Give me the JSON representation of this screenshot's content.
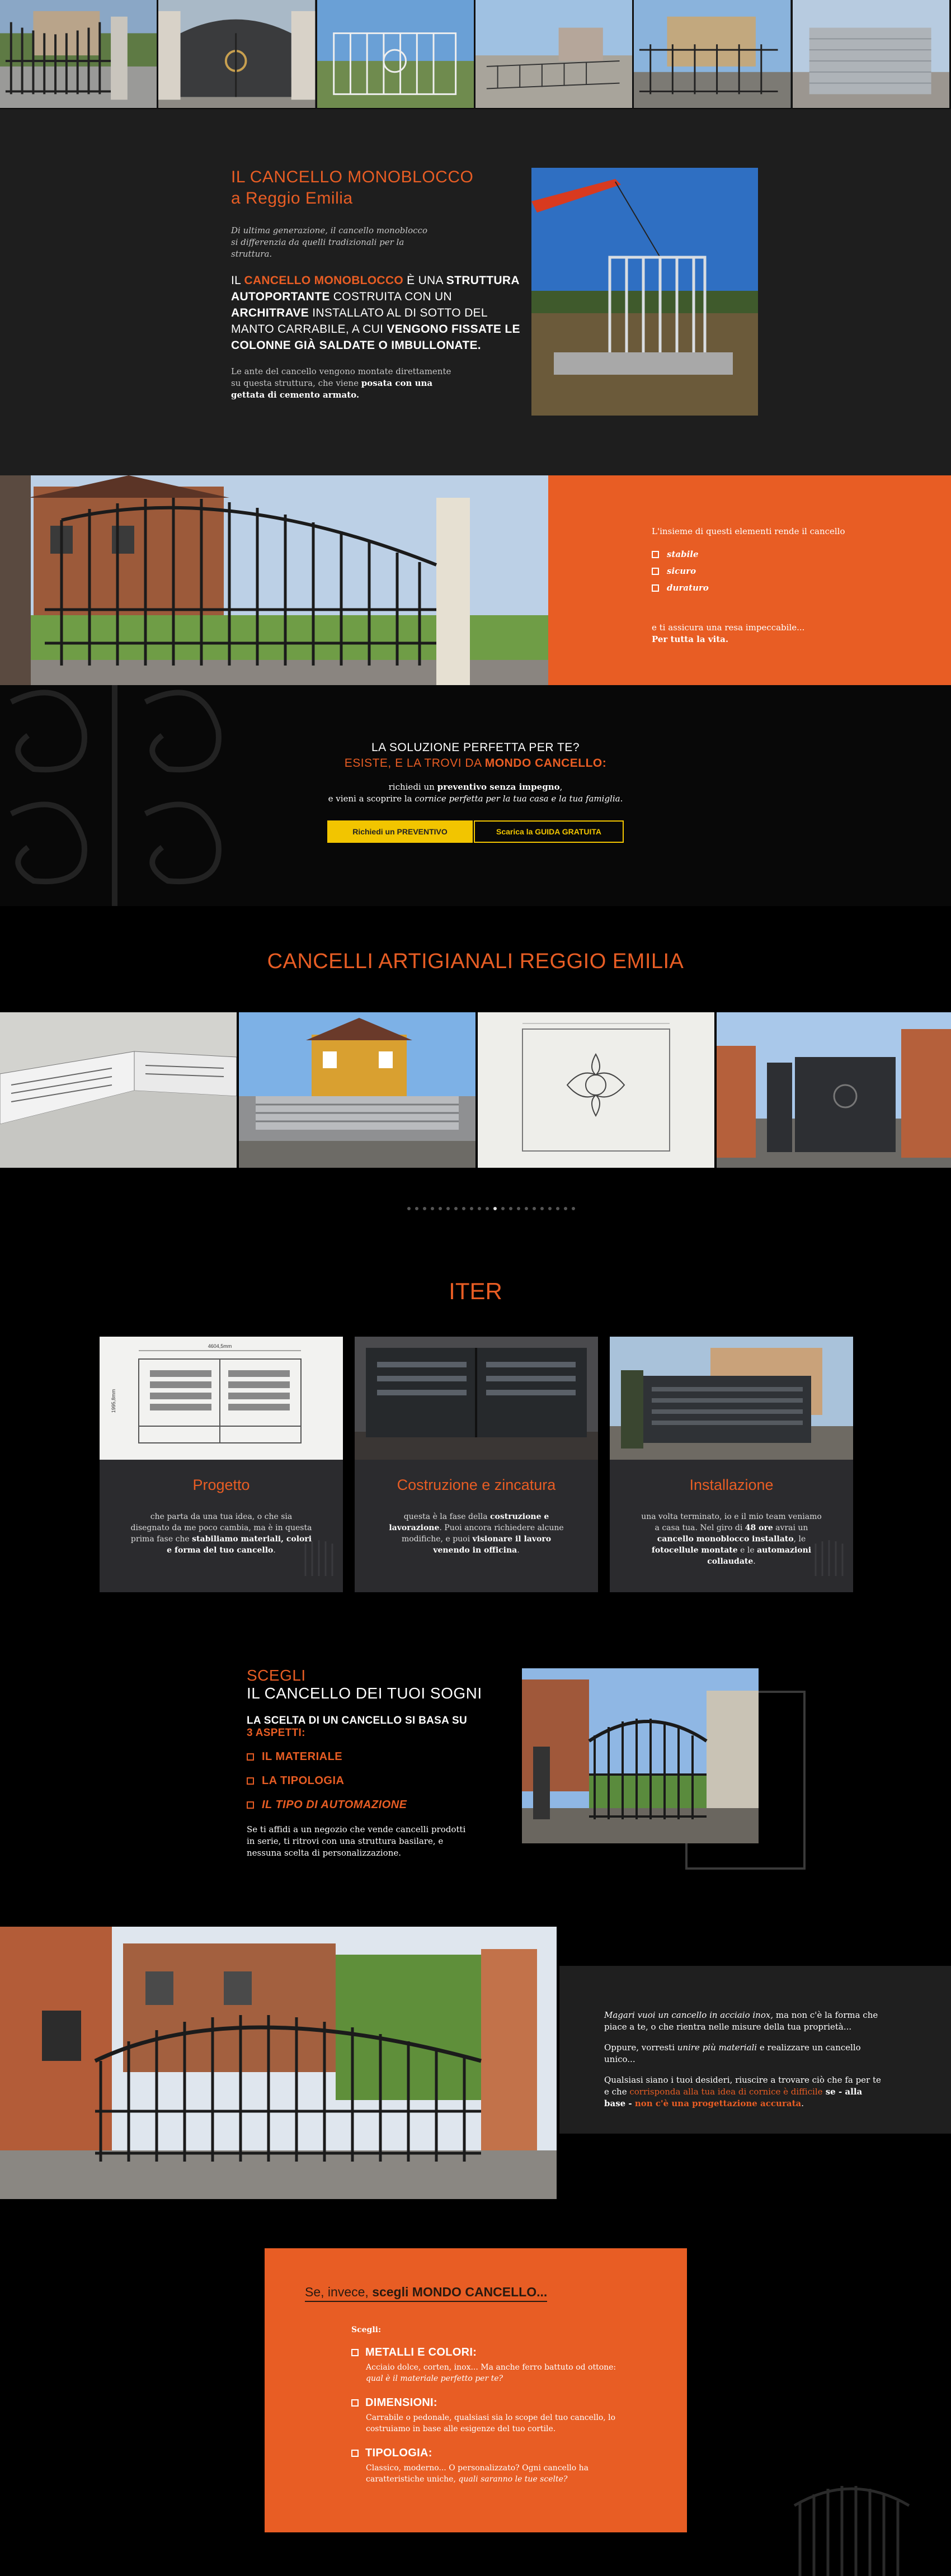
{
  "monoblocco": {
    "title_line1": "IL CANCELLO MONOBLOCCO",
    "title_line2": "a Reggio Emilia",
    "intro": "Di ultima generazione, il cancello monoblocco si differenzia da quelli tradizionali per la struttura.",
    "caps_1": "IL ",
    "caps_2": "CANCELLO MONOBLOCCO",
    "caps_3": " È UNA ",
    "caps_4": "STRUTTURA AUTOPORTANTE",
    "caps_5": " COSTRUITA CON UN ",
    "caps_6": "ARCHITRAVE",
    "caps_7": " INSTALLATO AL DI SOTTO DEL MANTO CARRABILE, A CUI ",
    "caps_8": "VENGONO FISSATE LE COLONNE GIÀ SALDATE O IMBULLONATE.",
    "body_1": "Le ante del cancello vengono montate direttamente su questa struttura, che viene ",
    "body_2": "posata con una gettata di cemento armato."
  },
  "stabile": {
    "intro": "L'insieme di questi elementi rende il cancello",
    "items": [
      "stabile",
      "sicuro",
      "duraturo"
    ],
    "outro": "e ti assicura una resa impeccabile...",
    "outro_bold": "Per tutta la vita."
  },
  "soluzione": {
    "line1": "LA SOLUZIONE PERFETTA PER TE?",
    "line2a": "ESISTE, E LA TROVI DA ",
    "line2b": "MONDO CANCELLO:",
    "p1a": "richiedi un ",
    "p1b": "preventivo senza impegno",
    "p1c": ",",
    "p2a": "e vieni a scoprire la ",
    "p2b": "cornice perfetta per la tua casa e la tua famiglia",
    "p2c": ".",
    "btn_preventivo": "Richiedi un PREVENTIVO",
    "btn_guida": "Scarica la GUIDA GRATUITA"
  },
  "artigianali": {
    "title": "CANCELLI ARTIGIANALI REGGIO EMILIA",
    "dot_count": 22,
    "active_dot": 11
  },
  "iter": {
    "title": "ITER",
    "cards": [
      {
        "title": "Progetto",
        "text_a": "che parta da una tua idea, o che sia disegnato da me poco cambia, ma è in questa prima fase che ",
        "text_b": "stabiliamo materiali, colori e forma del tuo cancello",
        "text_c": "."
      },
      {
        "title": "Costruzione e zincatura",
        "text_a": "questa è la fase della ",
        "text_b": "costruzione e lavorazione",
        "text_c": ". Puoi ancora richiedere alcune modifiche, e puoi ",
        "text_d": "visionare il lavoro venendo in officina",
        "text_e": "."
      },
      {
        "title": "Installazione",
        "text_a": "una volta terminato, io e il mio team veniamo a casa tua. Nel giro di ",
        "text_b": "48 ore",
        "text_c": " avrai un ",
        "text_d": "cancello monoblocco installato",
        "text_e": ", le ",
        "text_f": "fotocellule montate",
        "text_g": " e le ",
        "text_h": "automazioni collaudate",
        "text_i": "."
      }
    ],
    "drawing_dim_top": "4604,5mm",
    "drawing_dim_left": "1995,8mm"
  },
  "scegli": {
    "kicker": "SCEGLI",
    "title": "IL CANCELLO DEI TUOI SOGNI",
    "sub1": "LA SCELTA DI UN CANCELLO SI BASA SU",
    "sub2": "3 ASPETTI:",
    "options": [
      "IL MATERIALE",
      "LA TIPOLOGIA",
      "IL TIPO DI AUTOMAZIONE"
    ],
    "body": "Se ti affidi a un negozio che vende cancelli prodotti in serie, ti ritrovi con una struttura basilare, e nessuna scelta di personalizzazione."
  },
  "magari": {
    "p1a": "Magari vuoi un cancello in acciaio inox,",
    "p1b": " ma non c'è la forma che piace a te, o che rientra nelle misure della tua proprietà...",
    "p2a": "Oppure, vorresti ",
    "p2b": "unire più materiali",
    "p2c": " e realizzare un cancello unico...",
    "p3a": "Qualsiasi siano i tuoi desideri, riuscire a trovare ciò che fa per te e che ",
    "p3b": "corrisponda alla tua idea di cornice è difficile",
    "p3c": " se - alla base - ",
    "p3d": "non c'è una progettazione accurata",
    "p3e": "."
  },
  "mondo": {
    "title_a": "Se, invece, ",
    "title_b": "scegli MONDO CANCELLO...",
    "scegli": "Scegli:",
    "items": [
      {
        "title": "METALLI E COLORI:",
        "desc_a": "Acciaio dolce, corten, inox... Ma anche ferro battuto od ottone: ",
        "desc_b": "qual è il materiale perfetto per te?"
      },
      {
        "title": "DIMENSIONI:",
        "desc_a": "Carrabile o pedonale, qualsiasi sia lo scope del tuo cancello, lo costruiamo in base alle esigenze del tuo cortile.",
        "desc_b": ""
      },
      {
        "title": "TIPOLOGIA:",
        "desc_a": "Classico, moderno... O personalizzato? Ogni cancello ha caratteristiche uniche, ",
        "desc_b": "quali saranno le tue scelte?"
      }
    ]
  },
  "colors": {
    "accent": "#e85d24",
    "dark": "#1e1e1e",
    "yellow": "#f2c500"
  }
}
